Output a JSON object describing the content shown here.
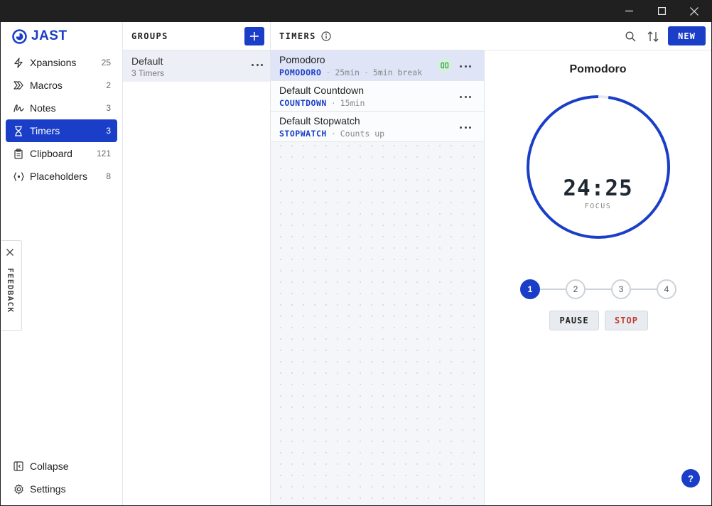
{
  "app": {
    "logo_text": "JAST",
    "accent_color": "#1a3ec7"
  },
  "sidebar": {
    "items": [
      {
        "label": "Xpansions",
        "count": "25",
        "icon": "lightning-icon"
      },
      {
        "label": "Macros",
        "count": "2",
        "icon": "chevrons-right-icon"
      },
      {
        "label": "Notes",
        "count": "3",
        "icon": "scribble-icon"
      },
      {
        "label": "Timers",
        "count": "3",
        "icon": "hourglass-icon",
        "active": true
      },
      {
        "label": "Clipboard",
        "count": "121",
        "icon": "clipboard-icon"
      },
      {
        "label": "Placeholders",
        "count": "8",
        "icon": "braces-icon"
      }
    ],
    "bottom": [
      {
        "label": "Collapse",
        "icon": "collapse-panel-icon"
      },
      {
        "label": "Settings",
        "icon": "gear-icon"
      }
    ]
  },
  "groups": {
    "title": "GROUPS",
    "items": [
      {
        "name": "Default",
        "sub": "3 Timers"
      }
    ]
  },
  "timers": {
    "title": "TIMERS",
    "new_label": "NEW",
    "items": [
      {
        "name": "Pomodoro",
        "type": "POMODORO",
        "meta1": "25min",
        "meta2": "5min break",
        "running": true
      },
      {
        "name": "Default Countdown",
        "type": "COUNTDOWN",
        "meta1": "15min"
      },
      {
        "name": "Default Stopwatch",
        "type": "STOPWATCH",
        "meta1": "Counts up"
      }
    ]
  },
  "detail": {
    "title": "Pomodoro",
    "time": "24:25",
    "phase": "FOCUS",
    "progress_fraction": 0.977,
    "steps": [
      "1",
      "2",
      "3",
      "4"
    ],
    "active_step": 0,
    "pause_label": "PAUSE",
    "stop_label": "STOP",
    "stop_color": "#c0392b",
    "help_label": "?"
  },
  "feedback": {
    "label": "FEEDBACK"
  }
}
